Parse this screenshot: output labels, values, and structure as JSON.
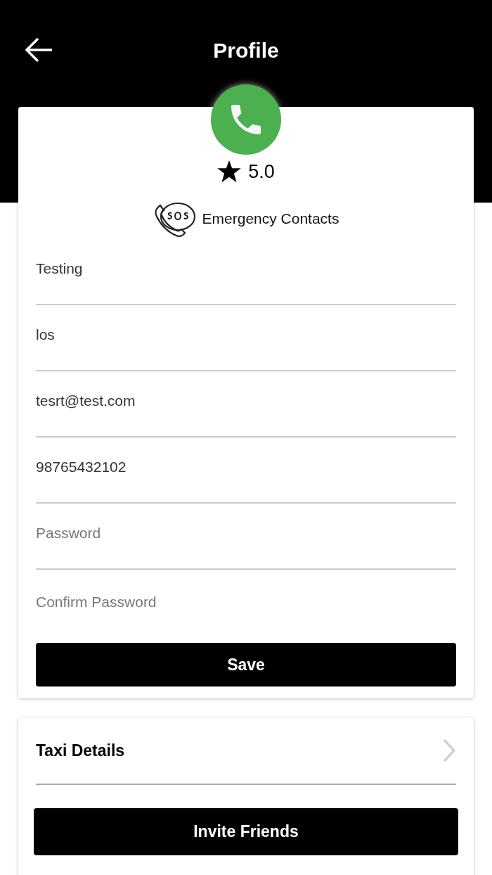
{
  "header": {
    "title": "Profile"
  },
  "profile": {
    "rating": "5.0",
    "emergency_label": "Emergency Contacts"
  },
  "fields": [
    {
      "value": "Testing"
    },
    {
      "value": "los"
    },
    {
      "value": "tesrt@test.com"
    },
    {
      "value": "98765432102"
    },
    {
      "placeholder": "Password"
    },
    {
      "placeholder": "Confirm Password"
    }
  ],
  "save_button": "Save",
  "menu": [
    {
      "label": "Taxi Details"
    }
  ],
  "invite_button": "Invite Friends"
}
